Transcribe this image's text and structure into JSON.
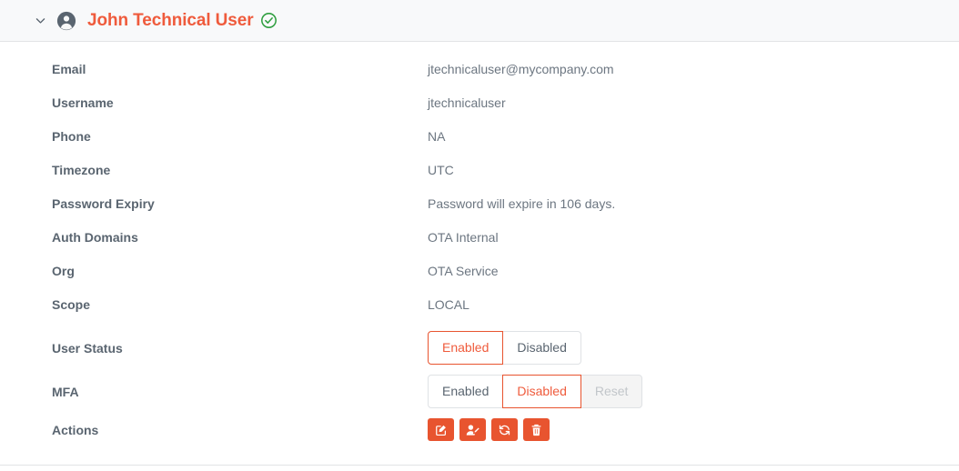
{
  "header": {
    "collapse_icon": "chevron-down-icon",
    "avatar_icon": "user-avatar-icon",
    "title": "John Technical User",
    "verified_icon": "check-circle-icon"
  },
  "details": {
    "rows": [
      {
        "label": "Email",
        "value": "jtechnicaluser@mycompany.com"
      },
      {
        "label": "Username",
        "value": "jtechnicaluser"
      },
      {
        "label": "Phone",
        "value": "NA"
      },
      {
        "label": "Timezone",
        "value": "UTC"
      },
      {
        "label": "Password Expiry",
        "value": "Password will expire in 106 days."
      },
      {
        "label": "Auth Domains",
        "value": "OTA Internal"
      },
      {
        "label": "Org",
        "value": "OTA Service"
      },
      {
        "label": "Scope",
        "value": "LOCAL"
      }
    ],
    "user_status": {
      "label": "User Status",
      "options": [
        {
          "label": "Enabled",
          "state": "active"
        },
        {
          "label": "Disabled",
          "state": "normal"
        }
      ]
    },
    "mfa": {
      "label": "MFA",
      "options": [
        {
          "label": "Enabled",
          "state": "normal"
        },
        {
          "label": "Disabled",
          "state": "active"
        },
        {
          "label": "Reset",
          "state": "disabled"
        }
      ]
    },
    "actions": {
      "label": "Actions",
      "buttons": [
        {
          "icon": "edit-icon"
        },
        {
          "icon": "user-edit-icon"
        },
        {
          "icon": "sync-icon"
        },
        {
          "icon": "trash-icon"
        }
      ]
    }
  },
  "colors": {
    "accent": "#e8542f",
    "title": "#ef5b3c",
    "label": "#5a6570",
    "value": "#6c7681",
    "verified": "#2e9e3e",
    "header_bg": "#f8f9fa",
    "border": "#e2e4e6"
  }
}
